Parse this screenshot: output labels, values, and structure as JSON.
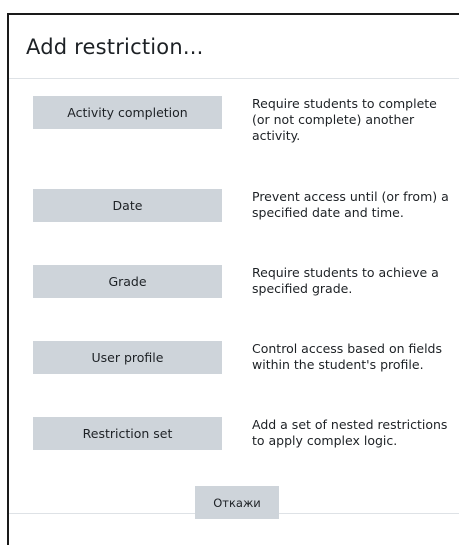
{
  "dialog": {
    "title": "Add restriction..."
  },
  "options": [
    {
      "button": "Activity completion",
      "description": "Require students to complete (or not complete) another activity."
    },
    {
      "button": "Date",
      "description": "Prevent access until (or from) a specified date and time."
    },
    {
      "button": "Grade",
      "description": "Require students to achieve a specified grade."
    },
    {
      "button": "User profile",
      "description": "Control access based on fields within the student's profile."
    },
    {
      "button": "Restriction set",
      "description": "Add a set of nested restrictions to apply complex logic."
    }
  ],
  "footer": {
    "cancel_label": "Откажи"
  },
  "colors": {
    "button_bg": "#ced4da",
    "text": "#1d2125",
    "divider": "#dee2e6"
  }
}
